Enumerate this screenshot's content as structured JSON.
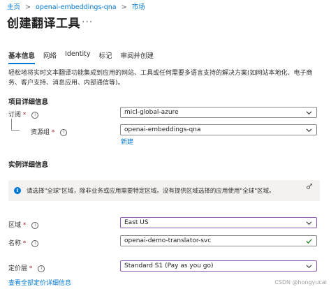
{
  "breadcrumb": {
    "items": [
      "主页",
      "openai-embeddings-qna",
      "市场"
    ],
    "separator": ">"
  },
  "page": {
    "title": "创建翻译工具",
    "more": "..."
  },
  "tabs": [
    {
      "label": "基本信息",
      "active": true
    },
    {
      "label": "网络",
      "active": false
    },
    {
      "label": "Identity",
      "active": false
    },
    {
      "label": "标记",
      "active": false
    },
    {
      "label": "审阅并创建",
      "active": false
    }
  ],
  "description": "轻松地将实时文本翻译功能集成到应用的网站、工具或任何需要多语言支持的解决方案(如网站本地化、电子商务、客户支持、消息应用、内部通信等)。",
  "project": {
    "heading": "项目详细信息",
    "subscription": {
      "label": "订阅",
      "required": "*",
      "value": "micl-global-azure"
    },
    "resource_group": {
      "label": "资源组",
      "required": "*",
      "value": "openai-embeddings-qna",
      "new_link": "新建"
    }
  },
  "instance": {
    "heading": "实例详细信息",
    "banner": {
      "icon": "i",
      "text": "请选择\"全球\"区域，除非业务或应用需要特定区域。没有提供区域选择的应用使用\"全球\"区域。"
    },
    "region": {
      "label": "区域",
      "required": "*",
      "value": "East US"
    },
    "name": {
      "label": "名称",
      "required": "*",
      "value": "openai-demo-translator-svc"
    },
    "pricing": {
      "label": "定价层",
      "required": "*",
      "value": "Standard S1 (Pay as you go)",
      "link": "查看全部定价详细信息"
    }
  },
  "watermark": "CSDN @hongyucai",
  "colors": {
    "accent": "#0078d4",
    "required": "#a4262c",
    "focus_border": "#8e5bb0"
  }
}
